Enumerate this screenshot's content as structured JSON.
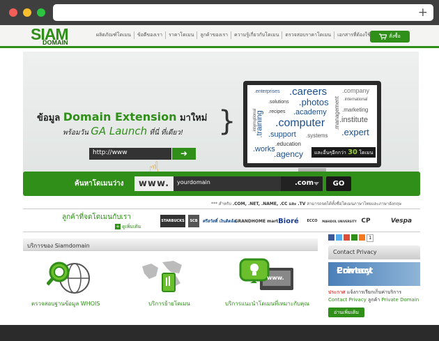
{
  "browser": {
    "plus_icon": "+"
  },
  "nav": {
    "logo_top": "SIAM",
    "logo_bottom": "DOMAIN",
    "items": [
      "ผลิตภัณฑ์โดเมน",
      "ข้อดีของเรา",
      "ราคาโดเมน",
      "ลูกค้าของเรา",
      "ความรู้เกี่ยวกับโดเมน",
      "ตรวจสอบราคาโดเมน",
      "เอกสารที่ต้องใช้"
    ],
    "cart_label": "สั่งซื้อ"
  },
  "banner": {
    "line1_pre": "ข้อมูล",
    "line1_hl": "Domain Extension",
    "line1_post": "มาใหม่",
    "line2_pre": "พร้อมวัน",
    "line2_hl": "GA Launch",
    "line2_post": "ที่นี่ ที่เดียว!",
    "url_text": "http://www",
    "screen_words": [
      ".enterprises",
      ".careers",
      ".company",
      ".solutions",
      ".photos",
      ".international",
      ".recipes",
      ".academy",
      ".marketing",
      ".computer",
      ".institute",
      ".support",
      ".systems",
      ".expert",
      ".education",
      ".works",
      ".agency",
      ".international",
      ".training",
      ".management"
    ],
    "pill_text": "และอื่นๆอีกกว่า",
    "pill_num": "30",
    "pill_unit": "โดเมน"
  },
  "search": {
    "label": "ค้นหาโดเมนว่าง",
    "www": "www.",
    "value": "yourdomain",
    "tld": ".com",
    "go": "GO"
  },
  "note": {
    "pre": "*** สำหรับ",
    "tlds": ".COM, .NET, .NAME, .CC และ .TV",
    "post": "สามารถจดได้ทั้งชื่อโดเมนภาษาไทยและภาษาอังกฤษ"
  },
  "customers": {
    "title": "ลูกค้าที่จดโดเมนกับเรา",
    "more": "ดูเพิ่มเติม",
    "logos": [
      "STARBUCKS",
      "SCB",
      "ศรีสวัสดิ์ เงินติดล้อ",
      "GRANDHOME mart",
      "Bioré",
      "ECCO",
      "MAHIDOL UNIVERSITY",
      "CP",
      "Vespa"
    ]
  },
  "services": {
    "title": "บริการของ Siamdomain",
    "items": [
      "ตรวจสอบฐานข้อมูล WHOIS",
      "บริการย้ายโดเมน",
      "บริการแนะนำโดเมนที่เหมาะกับคุณ"
    ],
    "www_label": "www."
  },
  "sidebar": {
    "social_count": "1",
    "title": "Contact Privacy",
    "img_line1": "Contact",
    "img_line2": "Privacy",
    "text_red": "ประกาศ",
    "text_1": "แจ้งการเรียกเก็บค่าบริการ",
    "text_2": "Contact Privacy",
    "text_3": "ลูกค้า",
    "text_4": "Private Domain",
    "button": "อ่านเพิ่มเติม"
  },
  "colors": {
    "brand_green": "#2f8f18",
    "dark": "#333333"
  }
}
